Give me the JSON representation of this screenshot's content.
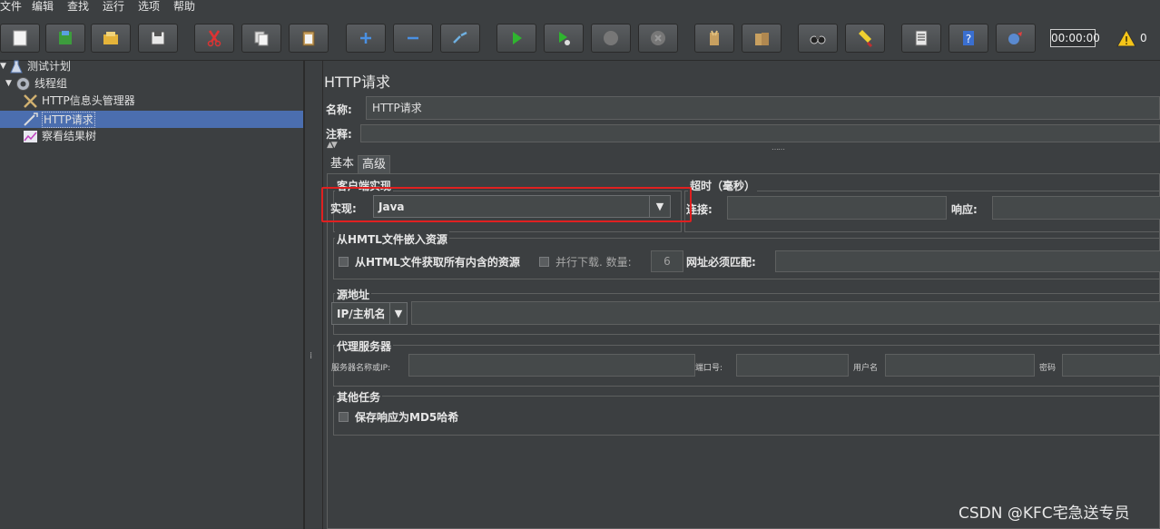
{
  "menu": [
    "文件",
    "编辑",
    "查找",
    "运行",
    "选项",
    "帮助"
  ],
  "toolbar": {
    "icons": [
      "new-icon",
      "templates-icon",
      "open-icon",
      "save-icon",
      "cut-icon",
      "copy-icon",
      "paste-icon",
      "expand-icon",
      "collapse-icon",
      "toggle-icon",
      "start-icon",
      "start-no-pause-icon",
      "stop-icon",
      "shutdown-icon",
      "clear-icon",
      "clear-all-icon",
      "search-icon",
      "reset-search-icon",
      "function-helper-icon",
      "help-icon",
      "remote-icon"
    ],
    "timer": "00:00:00",
    "warning_count": "0"
  },
  "tree": {
    "items": [
      {
        "label": "测试计划",
        "icon": "test-plan-icon"
      },
      {
        "label": "线程组",
        "icon": "thread-group-icon"
      },
      {
        "label": "HTTP信息头管理器",
        "icon": "header-manager-icon"
      },
      {
        "label": "HTTP请求",
        "icon": "http-request-icon"
      },
      {
        "label": "察看结果树",
        "icon": "results-tree-icon"
      }
    ]
  },
  "panel": {
    "title": "HTTP请求",
    "name_label": "名称:",
    "name_value": "HTTP请求",
    "comment_label": "注释:",
    "tabs": [
      "基本",
      "高级"
    ],
    "client_impl": {
      "group": "客户端实现",
      "label": "实现:",
      "value": "Java"
    },
    "timeout": {
      "group": "超时（毫秒）",
      "connect_label": "连接:",
      "response_label": "响应:"
    },
    "embedded": {
      "group": "从HMTL文件嵌入资源",
      "retrieve_label": "从HTML文件获取所有内含的资源",
      "parallel_label": "并行下载. 数量:",
      "parallel_value": "6",
      "url_match_label": "网址必须匹配:"
    },
    "source": {
      "group": "源地址",
      "type_value": "IP/主机名"
    },
    "proxy": {
      "group": "代理服务器",
      "host_label": "服务器名称或IP:",
      "port_label": "端口号:",
      "user_label": "用户名",
      "pass_label": "密码"
    },
    "other": {
      "group": "其他任务",
      "md5_label": "保存响应为MD5哈希"
    }
  },
  "watermark": "CSDN @KFC宅急送专员"
}
